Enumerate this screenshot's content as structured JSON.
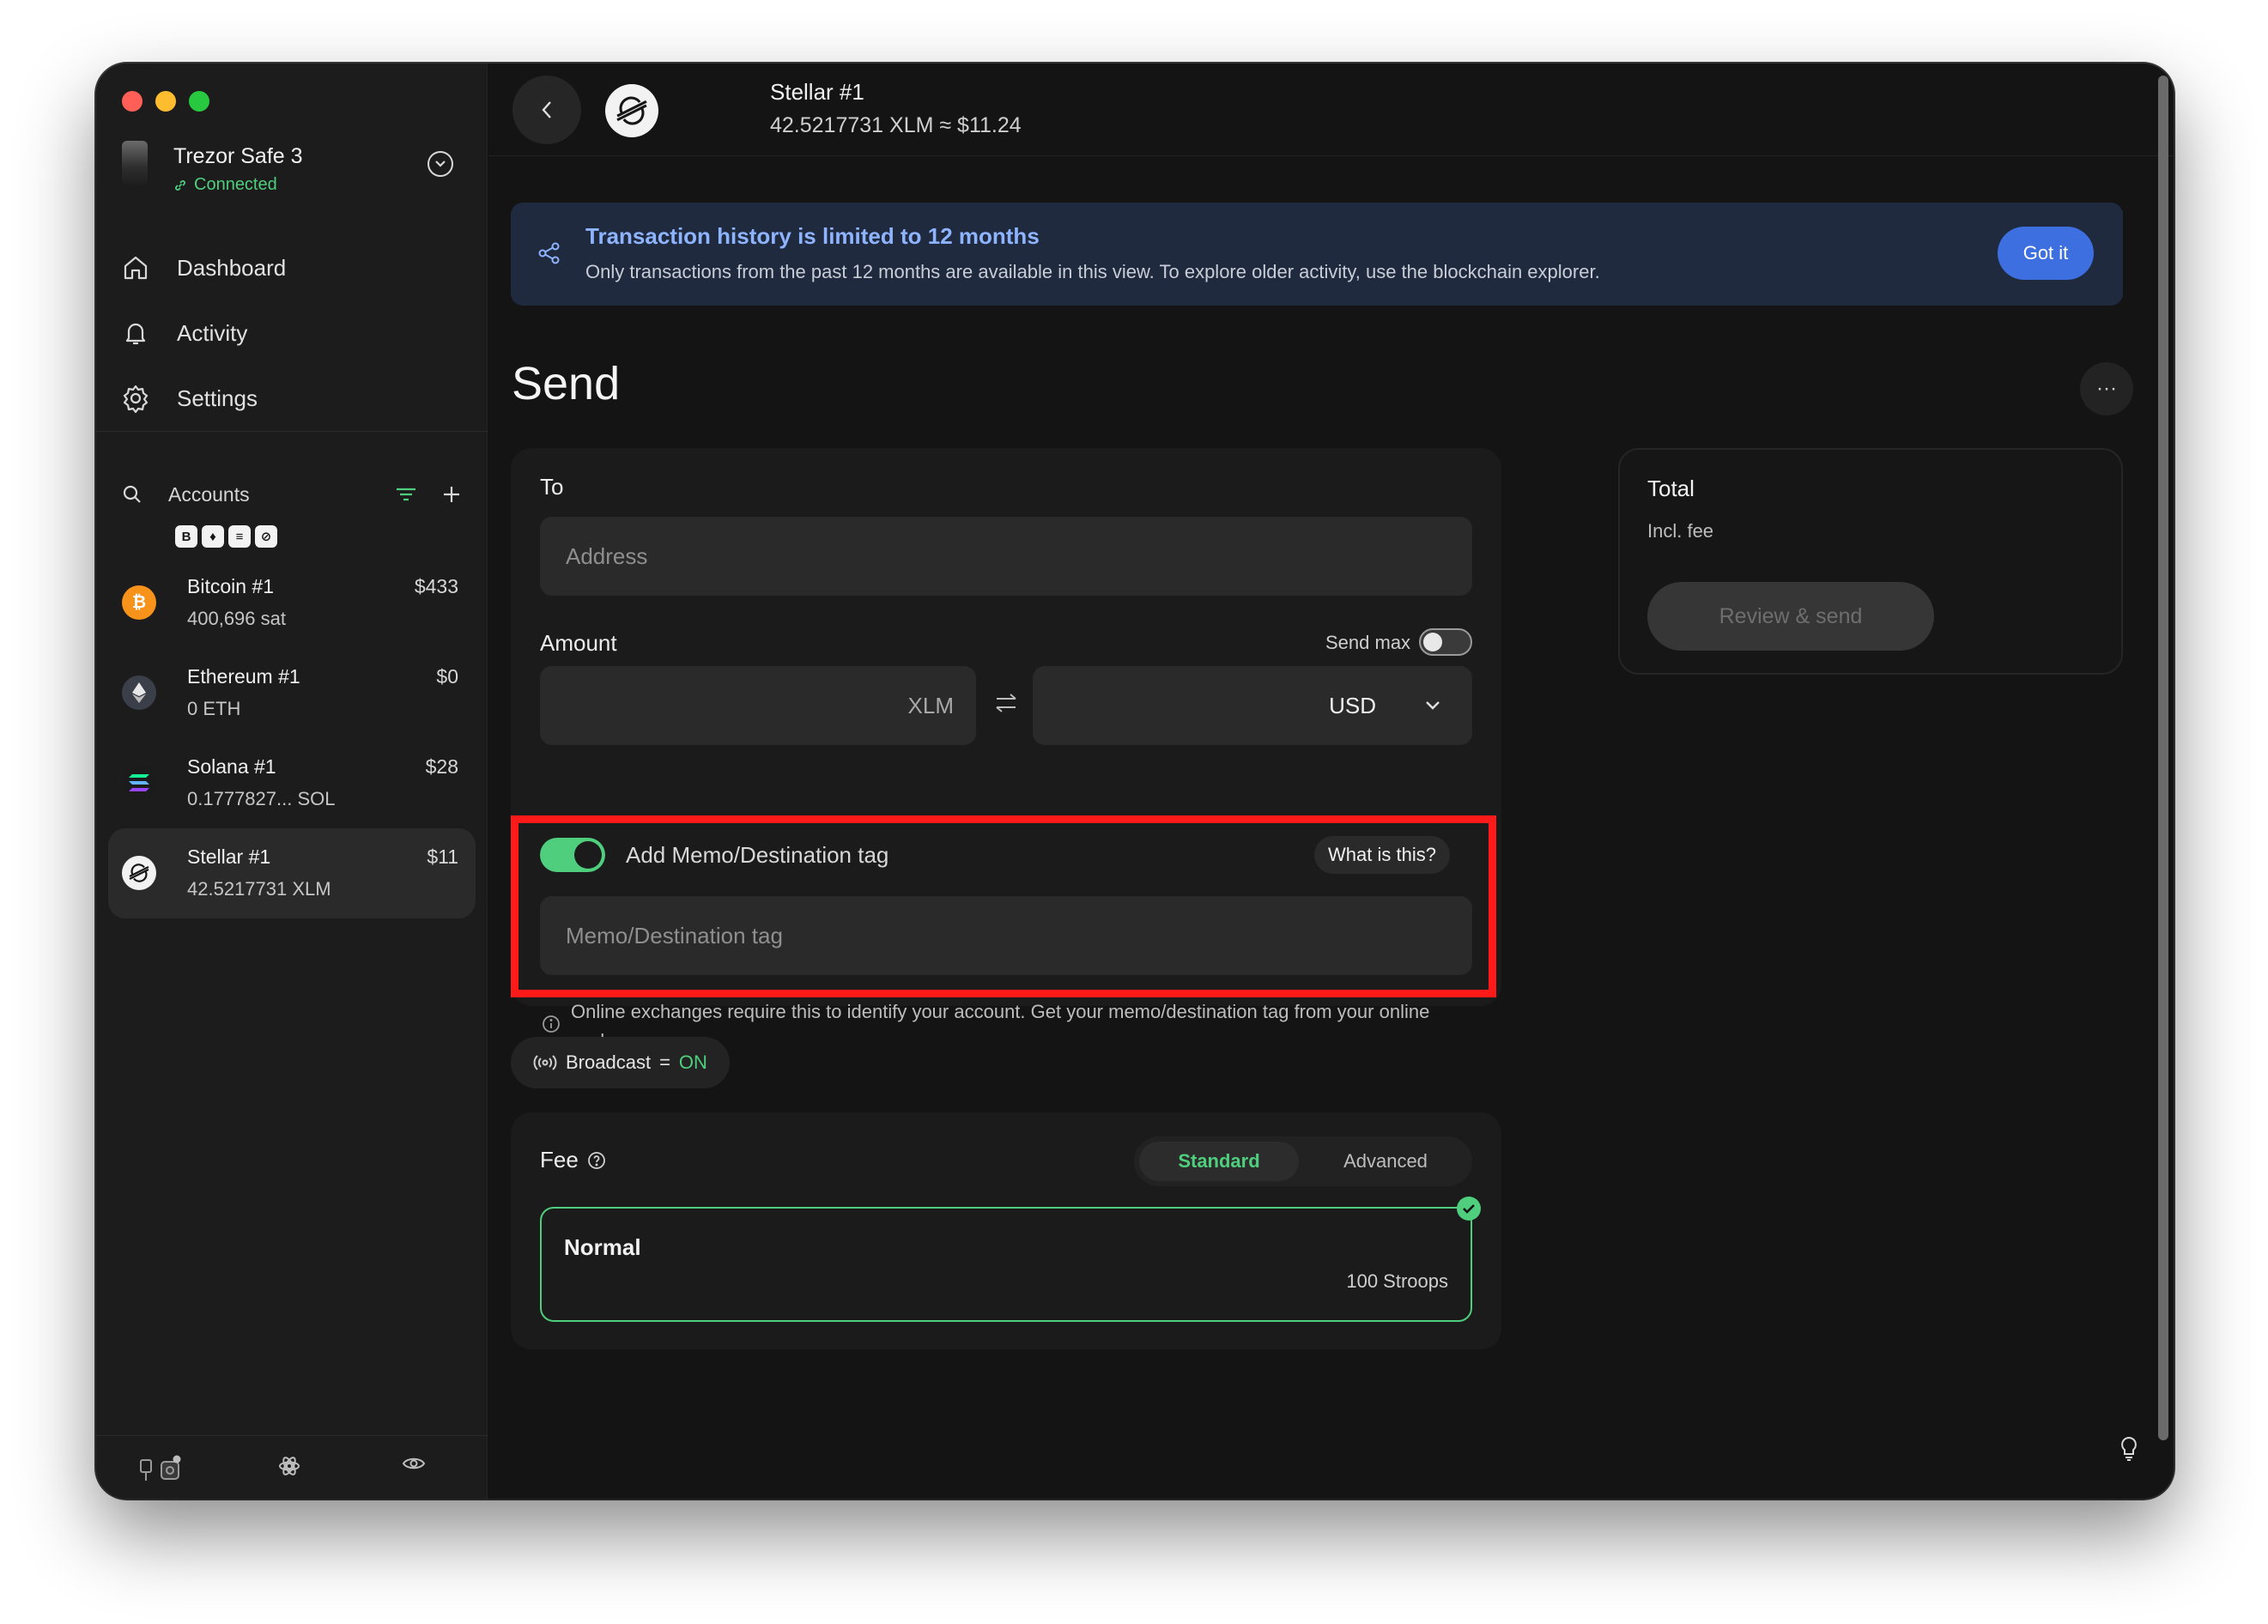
{
  "sidebar": {
    "device": {
      "name": "Trezor Safe 3",
      "status": "Connected"
    },
    "nav": [
      {
        "label": "Dashboard",
        "icon": "home-icon"
      },
      {
        "label": "Activity",
        "icon": "bell-icon"
      },
      {
        "label": "Settings",
        "icon": "gear-icon"
      }
    ],
    "accounts_label": "Accounts",
    "coin_filters": [
      "B",
      "♦",
      "≡",
      "⊘"
    ],
    "accounts": [
      {
        "name": "Bitcoin #1",
        "balance": "400,696 sat",
        "usd": "$433",
        "icon": "bitcoin-icon",
        "color": "#f7931a"
      },
      {
        "name": "Ethereum #1",
        "balance": "0 ETH",
        "usd": "$0",
        "icon": "ethereum-icon",
        "color": "#3a3f4a"
      },
      {
        "name": "Solana #1",
        "balance": "0.1777827... SOL",
        "usd": "$28",
        "icon": "solana-icon",
        "color": "#1b1b1b"
      },
      {
        "name": "Stellar #1",
        "balance": "42.5217731 XLM",
        "usd": "$11",
        "icon": "stellar-icon",
        "color": "#f2f2f2",
        "active": true
      }
    ]
  },
  "header": {
    "account_title": "Stellar #1",
    "account_sub": "42.5217731 XLM ≈ $11.24"
  },
  "banner": {
    "title": "Transaction history is limited to 12 months",
    "text": "Only transactions from the past 12 months are available in this view. To explore older activity, use the blockchain explorer.",
    "button": "Got it"
  },
  "send": {
    "title": "Send",
    "more": "···",
    "to_label": "To",
    "address_placeholder": "Address",
    "amount_label": "Amount",
    "send_max_label": "Send max",
    "crypto_unit": "XLM",
    "fiat_unit": "USD",
    "memo_toggle_label": "Add Memo/Destination tag",
    "what_is_this": "What is this?",
    "memo_placeholder": "Memo/Destination tag",
    "memo_hint": "Online exchanges require this to identify your account. Get your memo/destination tag from your online exchange."
  },
  "broadcast": {
    "label": "Broadcast",
    "eq": "=",
    "value": "ON"
  },
  "fee": {
    "label": "Fee",
    "tabs": [
      "Standard",
      "Advanced"
    ],
    "option_name": "Normal",
    "option_amount": "100 Stroops"
  },
  "total": {
    "title": "Total",
    "sub": "Incl. fee",
    "button": "Review & send"
  },
  "colors": {
    "accent_green": "#4fce7d",
    "banner_blue": "#3d6fe0",
    "highlight_red": "#ff1a1a"
  }
}
